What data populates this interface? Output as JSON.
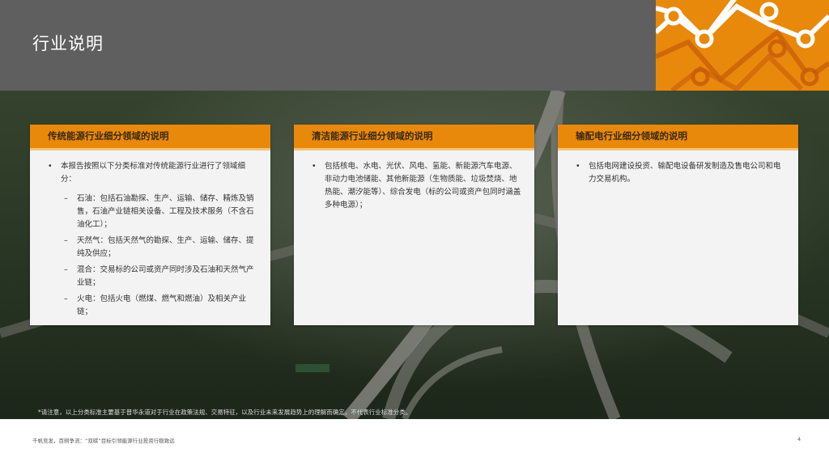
{
  "header": {
    "title": "行业说明"
  },
  "cards": [
    {
      "title": "传统能源行业细分领域的说明",
      "bullet": "本报告按照以下分类标准对传统能源行业进行了领域细分：",
      "subs": [
        "石油：包括石油勘探、生产、运输、储存、精炼及销售，石油产业链相关设备、工程及技术服务（不含石油化工）；",
        "天然气：包括天然气的勘探、生产、运输、储存、提纯及供应；",
        "混合：交易标的公司或资产同时涉及石油和天然气产业链；",
        "火电：包括火电（燃煤、燃气和燃油）及相关产业链；"
      ]
    },
    {
      "title": "清洁能源行业细分领域的说明",
      "bullet": "包括核电、水电、光伏、风电、氢能、新能源汽车电源、非动力电池储能、其他新能源（生物质能、垃圾焚烧、地热能、潮汐能等）、综合发电（标的公司或资产包同时涵盖多种电源）；"
    },
    {
      "title": "输配电行业细分领域的说明",
      "bullet": "包括电网建设投资、输配电设备研发制造及售电公司和电力交易机构。"
    }
  ],
  "note": "*请注意，以上分类标准主要基于普华永道对于行业在政策法规、交易特征，以及行业未来发展趋势上的理解而确定，不代表行业标准分类。",
  "footer": {
    "text": "千帆竞发，百舸争流：“双碳”目标引领能源行业投资行稳致远",
    "page": "4"
  },
  "colors": {
    "accent": "#e8890c",
    "header_bg": "#5f5f5f"
  }
}
